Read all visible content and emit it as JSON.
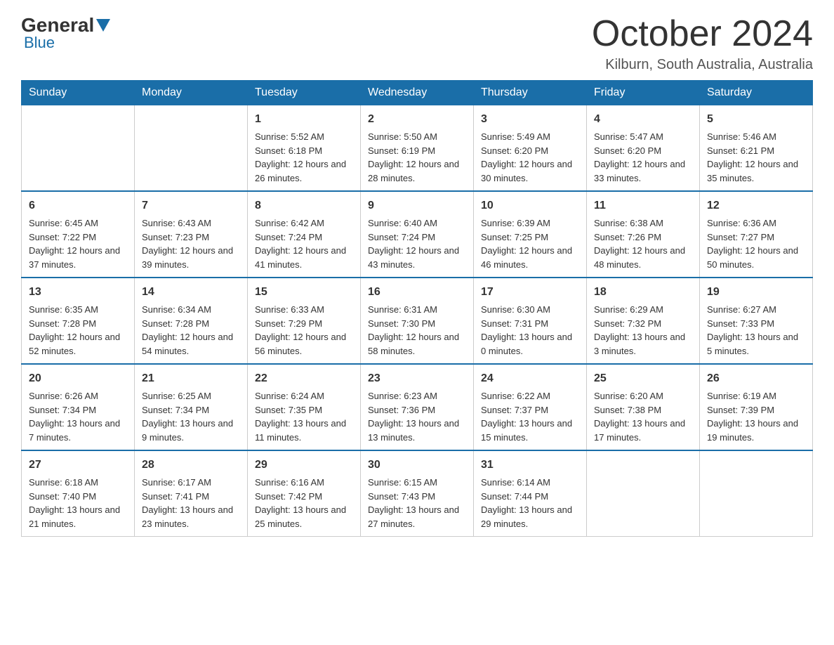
{
  "header": {
    "logo_general": "General",
    "logo_blue": "Blue",
    "month_title": "October 2024",
    "location": "Kilburn, South Australia, Australia"
  },
  "days_of_week": [
    "Sunday",
    "Monday",
    "Tuesday",
    "Wednesday",
    "Thursday",
    "Friday",
    "Saturday"
  ],
  "weeks": [
    [
      {
        "day": "",
        "sunrise": "",
        "sunset": "",
        "daylight": ""
      },
      {
        "day": "",
        "sunrise": "",
        "sunset": "",
        "daylight": ""
      },
      {
        "day": "1",
        "sunrise": "Sunrise: 5:52 AM",
        "sunset": "Sunset: 6:18 PM",
        "daylight": "Daylight: 12 hours and 26 minutes."
      },
      {
        "day": "2",
        "sunrise": "Sunrise: 5:50 AM",
        "sunset": "Sunset: 6:19 PM",
        "daylight": "Daylight: 12 hours and 28 minutes."
      },
      {
        "day": "3",
        "sunrise": "Sunrise: 5:49 AM",
        "sunset": "Sunset: 6:20 PM",
        "daylight": "Daylight: 12 hours and 30 minutes."
      },
      {
        "day": "4",
        "sunrise": "Sunrise: 5:47 AM",
        "sunset": "Sunset: 6:20 PM",
        "daylight": "Daylight: 12 hours and 33 minutes."
      },
      {
        "day": "5",
        "sunrise": "Sunrise: 5:46 AM",
        "sunset": "Sunset: 6:21 PM",
        "daylight": "Daylight: 12 hours and 35 minutes."
      }
    ],
    [
      {
        "day": "6",
        "sunrise": "Sunrise: 6:45 AM",
        "sunset": "Sunset: 7:22 PM",
        "daylight": "Daylight: 12 hours and 37 minutes."
      },
      {
        "day": "7",
        "sunrise": "Sunrise: 6:43 AM",
        "sunset": "Sunset: 7:23 PM",
        "daylight": "Daylight: 12 hours and 39 minutes."
      },
      {
        "day": "8",
        "sunrise": "Sunrise: 6:42 AM",
        "sunset": "Sunset: 7:24 PM",
        "daylight": "Daylight: 12 hours and 41 minutes."
      },
      {
        "day": "9",
        "sunrise": "Sunrise: 6:40 AM",
        "sunset": "Sunset: 7:24 PM",
        "daylight": "Daylight: 12 hours and 43 minutes."
      },
      {
        "day": "10",
        "sunrise": "Sunrise: 6:39 AM",
        "sunset": "Sunset: 7:25 PM",
        "daylight": "Daylight: 12 hours and 46 minutes."
      },
      {
        "day": "11",
        "sunrise": "Sunrise: 6:38 AM",
        "sunset": "Sunset: 7:26 PM",
        "daylight": "Daylight: 12 hours and 48 minutes."
      },
      {
        "day": "12",
        "sunrise": "Sunrise: 6:36 AM",
        "sunset": "Sunset: 7:27 PM",
        "daylight": "Daylight: 12 hours and 50 minutes."
      }
    ],
    [
      {
        "day": "13",
        "sunrise": "Sunrise: 6:35 AM",
        "sunset": "Sunset: 7:28 PM",
        "daylight": "Daylight: 12 hours and 52 minutes."
      },
      {
        "day": "14",
        "sunrise": "Sunrise: 6:34 AM",
        "sunset": "Sunset: 7:28 PM",
        "daylight": "Daylight: 12 hours and 54 minutes."
      },
      {
        "day": "15",
        "sunrise": "Sunrise: 6:33 AM",
        "sunset": "Sunset: 7:29 PM",
        "daylight": "Daylight: 12 hours and 56 minutes."
      },
      {
        "day": "16",
        "sunrise": "Sunrise: 6:31 AM",
        "sunset": "Sunset: 7:30 PM",
        "daylight": "Daylight: 12 hours and 58 minutes."
      },
      {
        "day": "17",
        "sunrise": "Sunrise: 6:30 AM",
        "sunset": "Sunset: 7:31 PM",
        "daylight": "Daylight: 13 hours and 0 minutes."
      },
      {
        "day": "18",
        "sunrise": "Sunrise: 6:29 AM",
        "sunset": "Sunset: 7:32 PM",
        "daylight": "Daylight: 13 hours and 3 minutes."
      },
      {
        "day": "19",
        "sunrise": "Sunrise: 6:27 AM",
        "sunset": "Sunset: 7:33 PM",
        "daylight": "Daylight: 13 hours and 5 minutes."
      }
    ],
    [
      {
        "day": "20",
        "sunrise": "Sunrise: 6:26 AM",
        "sunset": "Sunset: 7:34 PM",
        "daylight": "Daylight: 13 hours and 7 minutes."
      },
      {
        "day": "21",
        "sunrise": "Sunrise: 6:25 AM",
        "sunset": "Sunset: 7:34 PM",
        "daylight": "Daylight: 13 hours and 9 minutes."
      },
      {
        "day": "22",
        "sunrise": "Sunrise: 6:24 AM",
        "sunset": "Sunset: 7:35 PM",
        "daylight": "Daylight: 13 hours and 11 minutes."
      },
      {
        "day": "23",
        "sunrise": "Sunrise: 6:23 AM",
        "sunset": "Sunset: 7:36 PM",
        "daylight": "Daylight: 13 hours and 13 minutes."
      },
      {
        "day": "24",
        "sunrise": "Sunrise: 6:22 AM",
        "sunset": "Sunset: 7:37 PM",
        "daylight": "Daylight: 13 hours and 15 minutes."
      },
      {
        "day": "25",
        "sunrise": "Sunrise: 6:20 AM",
        "sunset": "Sunset: 7:38 PM",
        "daylight": "Daylight: 13 hours and 17 minutes."
      },
      {
        "day": "26",
        "sunrise": "Sunrise: 6:19 AM",
        "sunset": "Sunset: 7:39 PM",
        "daylight": "Daylight: 13 hours and 19 minutes."
      }
    ],
    [
      {
        "day": "27",
        "sunrise": "Sunrise: 6:18 AM",
        "sunset": "Sunset: 7:40 PM",
        "daylight": "Daylight: 13 hours and 21 minutes."
      },
      {
        "day": "28",
        "sunrise": "Sunrise: 6:17 AM",
        "sunset": "Sunset: 7:41 PM",
        "daylight": "Daylight: 13 hours and 23 minutes."
      },
      {
        "day": "29",
        "sunrise": "Sunrise: 6:16 AM",
        "sunset": "Sunset: 7:42 PM",
        "daylight": "Daylight: 13 hours and 25 minutes."
      },
      {
        "day": "30",
        "sunrise": "Sunrise: 6:15 AM",
        "sunset": "Sunset: 7:43 PM",
        "daylight": "Daylight: 13 hours and 27 minutes."
      },
      {
        "day": "31",
        "sunrise": "Sunrise: 6:14 AM",
        "sunset": "Sunset: 7:44 PM",
        "daylight": "Daylight: 13 hours and 29 minutes."
      },
      {
        "day": "",
        "sunrise": "",
        "sunset": "",
        "daylight": ""
      },
      {
        "day": "",
        "sunrise": "",
        "sunset": "",
        "daylight": ""
      }
    ]
  ]
}
